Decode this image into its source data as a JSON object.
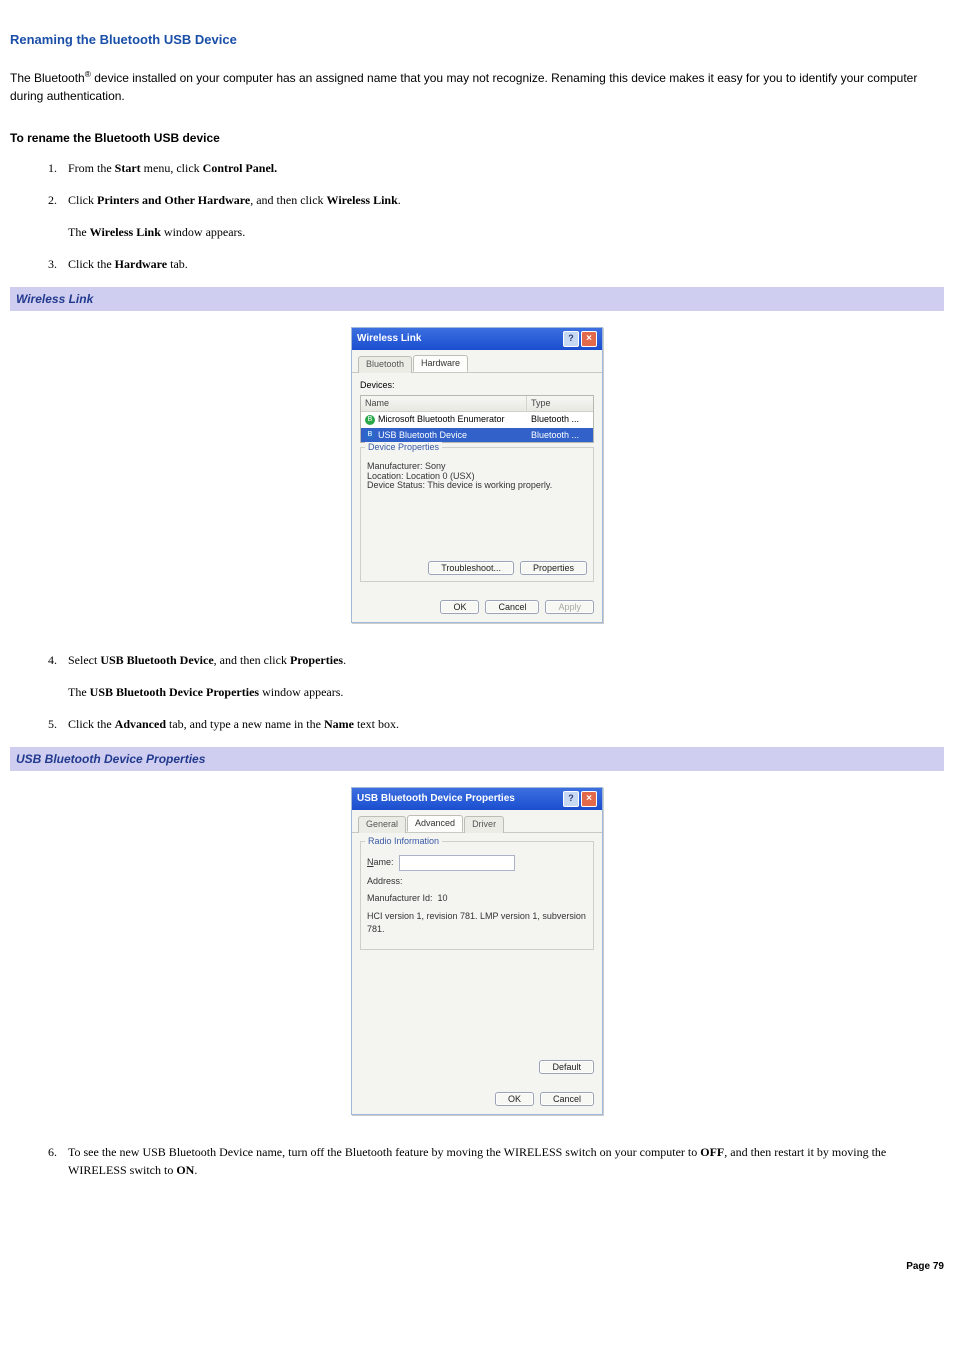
{
  "doc": {
    "title": "Renaming the Bluetooth USB Device",
    "intro_prefix": "The Bluetooth",
    "intro_suffix": " device installed on your computer has an assigned name that you may not recognize. Renaming this device makes it easy for you to identify your computer during authentication.",
    "reg_mark": "®",
    "subhead": "To rename the Bluetooth USB device",
    "page_label": "Page 79"
  },
  "steps": {
    "s1_a": "From the ",
    "s1_b": "Start",
    "s1_c": " menu, click ",
    "s1_d": "Control Panel.",
    "s2_a": "Click ",
    "s2_b": "Printers and Other Hardware",
    "s2_c": ", and then click ",
    "s2_d": "Wireless Link",
    "s2_e": ".",
    "s2_sub_a": "The ",
    "s2_sub_b": "Wireless Link",
    "s2_sub_c": " window appears.",
    "s3_a": "Click the ",
    "s3_b": "Hardware",
    "s3_c": " tab.",
    "s4_a": "Select ",
    "s4_b": "USB Bluetooth Device",
    "s4_c": ", and then click ",
    "s4_d": "Properties",
    "s4_e": ".",
    "s4_sub_a": "The ",
    "s4_sub_b": "USB Bluetooth Device Properties",
    "s4_sub_c": " window appears.",
    "s5_a": "Click the ",
    "s5_b": "Advanced",
    "s5_c": " tab, and type a new name in the ",
    "s5_d": "Name",
    "s5_e": " text box.",
    "s6_a": "To see the new USB Bluetooth Device name, turn off the Bluetooth feature by moving the WIRELESS switch on your computer to ",
    "s6_b": "OFF",
    "s6_c": ", and then restart it by moving the WIRELESS switch to ",
    "s6_d": "ON",
    "s6_e": "."
  },
  "captions": {
    "fig1": "Wireless Link",
    "fig2": "USB Bluetooth Device Properties"
  },
  "dlg1": {
    "title": "Wireless Link",
    "help_glyph": "?",
    "close_glyph": "×",
    "tab_bluetooth": "Bluetooth",
    "tab_hardware": "Hardware",
    "devices_label": "Devices:",
    "col_name": "Name",
    "col_type": "Type",
    "row1_name": "Microsoft Bluetooth Enumerator",
    "row1_type": "Bluetooth ...",
    "row2_name": "USB Bluetooth Device",
    "row2_type": "Bluetooth ...",
    "props_legend": "Device Properties",
    "manufacturer": "Manufacturer: Sony",
    "location": "Location: Location 0 (USX)",
    "status": "Device Status: This device is working properly.",
    "btn_troubleshoot": "Troubleshoot...",
    "btn_properties": "Properties",
    "btn_ok": "OK",
    "btn_cancel": "Cancel",
    "btn_apply": "Apply"
  },
  "dlg2": {
    "title": "USB Bluetooth Device Properties",
    "help_glyph": "?",
    "close_glyph": "×",
    "tab_general": "General",
    "tab_advanced": "Advanced",
    "tab_driver": "Driver",
    "group_legend": "Radio Information",
    "name_label": "Name:",
    "name_underline_char": "N",
    "address_label": "Address:",
    "mfg_label": "Manufacturer Id:",
    "mfg_value": "10",
    "hci_line": "HCI version 1, revision 781.  LMP version 1, subversion 781.",
    "btn_default": "Default",
    "btn_ok": "OK",
    "btn_cancel": "Cancel"
  }
}
